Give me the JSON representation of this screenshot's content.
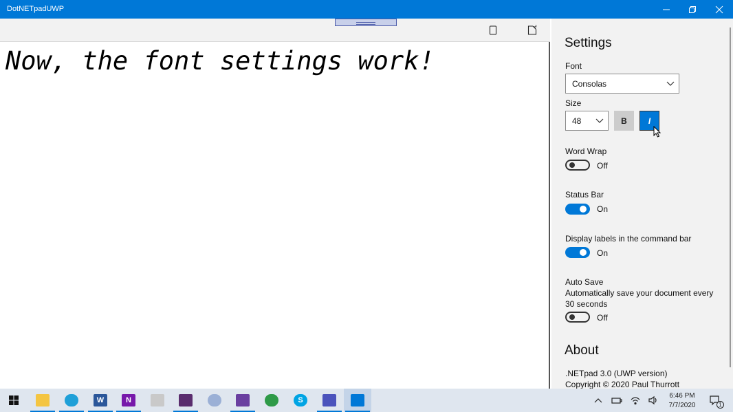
{
  "window": {
    "title": "DotNETpadUWP"
  },
  "editor": {
    "text": "Now, the font settings work!"
  },
  "settings": {
    "title": "Settings",
    "font_label": "Font",
    "font_value": "Consolas",
    "size_label": "Size",
    "size_value": "48",
    "bold_label": "B",
    "italic_label": "I",
    "word_wrap": {
      "label": "Word Wrap",
      "state": "Off"
    },
    "status_bar": {
      "label": "Status Bar",
      "state": "On"
    },
    "display_labels": {
      "label": "Display labels in the command bar",
      "state": "On"
    },
    "auto_save": {
      "label": "Auto Save",
      "description": "Automatically save your document every 30 seconds",
      "state": "Off"
    },
    "about": {
      "title": "About",
      "version": ".NETpad 3.0 (UWP version)",
      "copyright": "Copyright © 2020 Paul Thurrott"
    }
  },
  "taskbar": {
    "apps": [
      "start-icon",
      "file-explorer-icon",
      "edge-icon",
      "word-icon",
      "onenote-icon",
      "notepad-icon",
      "affinity-photo-icon",
      "paint-icon",
      "visual-studio-icon",
      "maps-icon",
      "skype-icon",
      "teams-icon",
      "dotnetpad-icon"
    ],
    "time": "6:46 PM",
    "date": "7/7/2020",
    "notification_count": "1"
  },
  "colors": {
    "accent": "#0078d7",
    "pane_bg": "#f2f2f2",
    "taskbar_bg": "#dfe6ef"
  }
}
